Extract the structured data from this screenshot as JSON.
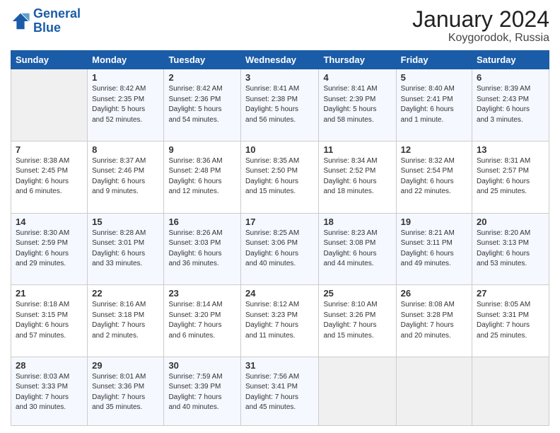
{
  "logo": {
    "text_general": "General",
    "text_blue": "Blue"
  },
  "header": {
    "month": "January 2024",
    "location": "Koygorodok, Russia"
  },
  "weekdays": [
    "Sunday",
    "Monday",
    "Tuesday",
    "Wednesday",
    "Thursday",
    "Friday",
    "Saturday"
  ],
  "weeks": [
    [
      {
        "day": "",
        "info": ""
      },
      {
        "day": "1",
        "info": "Sunrise: 8:42 AM\nSunset: 2:35 PM\nDaylight: 5 hours\nand 52 minutes."
      },
      {
        "day": "2",
        "info": "Sunrise: 8:42 AM\nSunset: 2:36 PM\nDaylight: 5 hours\nand 54 minutes."
      },
      {
        "day": "3",
        "info": "Sunrise: 8:41 AM\nSunset: 2:38 PM\nDaylight: 5 hours\nand 56 minutes."
      },
      {
        "day": "4",
        "info": "Sunrise: 8:41 AM\nSunset: 2:39 PM\nDaylight: 5 hours\nand 58 minutes."
      },
      {
        "day": "5",
        "info": "Sunrise: 8:40 AM\nSunset: 2:41 PM\nDaylight: 6 hours\nand 1 minute."
      },
      {
        "day": "6",
        "info": "Sunrise: 8:39 AM\nSunset: 2:43 PM\nDaylight: 6 hours\nand 3 minutes."
      }
    ],
    [
      {
        "day": "7",
        "info": "Sunrise: 8:38 AM\nSunset: 2:45 PM\nDaylight: 6 hours\nand 6 minutes."
      },
      {
        "day": "8",
        "info": "Sunrise: 8:37 AM\nSunset: 2:46 PM\nDaylight: 6 hours\nand 9 minutes."
      },
      {
        "day": "9",
        "info": "Sunrise: 8:36 AM\nSunset: 2:48 PM\nDaylight: 6 hours\nand 12 minutes."
      },
      {
        "day": "10",
        "info": "Sunrise: 8:35 AM\nSunset: 2:50 PM\nDaylight: 6 hours\nand 15 minutes."
      },
      {
        "day": "11",
        "info": "Sunrise: 8:34 AM\nSunset: 2:52 PM\nDaylight: 6 hours\nand 18 minutes."
      },
      {
        "day": "12",
        "info": "Sunrise: 8:32 AM\nSunset: 2:54 PM\nDaylight: 6 hours\nand 22 minutes."
      },
      {
        "day": "13",
        "info": "Sunrise: 8:31 AM\nSunset: 2:57 PM\nDaylight: 6 hours\nand 25 minutes."
      }
    ],
    [
      {
        "day": "14",
        "info": "Sunrise: 8:30 AM\nSunset: 2:59 PM\nDaylight: 6 hours\nand 29 minutes."
      },
      {
        "day": "15",
        "info": "Sunrise: 8:28 AM\nSunset: 3:01 PM\nDaylight: 6 hours\nand 33 minutes."
      },
      {
        "day": "16",
        "info": "Sunrise: 8:26 AM\nSunset: 3:03 PM\nDaylight: 6 hours\nand 36 minutes."
      },
      {
        "day": "17",
        "info": "Sunrise: 8:25 AM\nSunset: 3:06 PM\nDaylight: 6 hours\nand 40 minutes."
      },
      {
        "day": "18",
        "info": "Sunrise: 8:23 AM\nSunset: 3:08 PM\nDaylight: 6 hours\nand 44 minutes."
      },
      {
        "day": "19",
        "info": "Sunrise: 8:21 AM\nSunset: 3:11 PM\nDaylight: 6 hours\nand 49 minutes."
      },
      {
        "day": "20",
        "info": "Sunrise: 8:20 AM\nSunset: 3:13 PM\nDaylight: 6 hours\nand 53 minutes."
      }
    ],
    [
      {
        "day": "21",
        "info": "Sunrise: 8:18 AM\nSunset: 3:15 PM\nDaylight: 6 hours\nand 57 minutes."
      },
      {
        "day": "22",
        "info": "Sunrise: 8:16 AM\nSunset: 3:18 PM\nDaylight: 7 hours\nand 2 minutes."
      },
      {
        "day": "23",
        "info": "Sunrise: 8:14 AM\nSunset: 3:20 PM\nDaylight: 7 hours\nand 6 minutes."
      },
      {
        "day": "24",
        "info": "Sunrise: 8:12 AM\nSunset: 3:23 PM\nDaylight: 7 hours\nand 11 minutes."
      },
      {
        "day": "25",
        "info": "Sunrise: 8:10 AM\nSunset: 3:26 PM\nDaylight: 7 hours\nand 15 minutes."
      },
      {
        "day": "26",
        "info": "Sunrise: 8:08 AM\nSunset: 3:28 PM\nDaylight: 7 hours\nand 20 minutes."
      },
      {
        "day": "27",
        "info": "Sunrise: 8:05 AM\nSunset: 3:31 PM\nDaylight: 7 hours\nand 25 minutes."
      }
    ],
    [
      {
        "day": "28",
        "info": "Sunrise: 8:03 AM\nSunset: 3:33 PM\nDaylight: 7 hours\nand 30 minutes."
      },
      {
        "day": "29",
        "info": "Sunrise: 8:01 AM\nSunset: 3:36 PM\nDaylight: 7 hours\nand 35 minutes."
      },
      {
        "day": "30",
        "info": "Sunrise: 7:59 AM\nSunset: 3:39 PM\nDaylight: 7 hours\nand 40 minutes."
      },
      {
        "day": "31",
        "info": "Sunrise: 7:56 AM\nSunset: 3:41 PM\nDaylight: 7 hours\nand 45 minutes."
      },
      {
        "day": "",
        "info": ""
      },
      {
        "day": "",
        "info": ""
      },
      {
        "day": "",
        "info": ""
      }
    ]
  ]
}
